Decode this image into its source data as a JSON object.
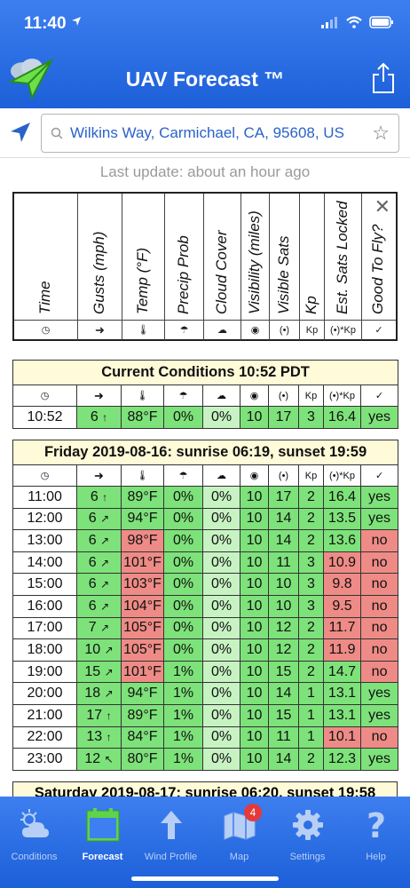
{
  "status": {
    "time": "11:40"
  },
  "header": {
    "title": "UAV Forecast ™"
  },
  "search": {
    "text": "Wilkins Way, Carmichael, CA, 95608, US"
  },
  "last_update": "Last update: about an hour ago",
  "legend": {
    "columns": [
      "Time",
      "Gusts (mph)",
      "Temp (°F)",
      "Precip Prob",
      "Cloud Cover",
      "Visibility (miles)",
      "Visible Sats",
      "Kp",
      "Est. Sats Locked",
      "Good To Fly?"
    ],
    "icons": [
      "clock-icon",
      "arrow-icon",
      "thermometer-icon",
      "rain-cloud-icon",
      "cloud-icon",
      "eye-icon",
      "satellite-icon",
      "kp-text",
      "sats-kp-text",
      "check-circle-icon"
    ],
    "kp_label": "Kp",
    "sats_kp_label": "(•)*Kp"
  },
  "current": {
    "title": "Current Conditions 10:52 PDT",
    "row": {
      "time": "10:52",
      "gust": "6",
      "arrow": "↑",
      "temp": "88°F",
      "precip": "0%",
      "cloud": "0%",
      "vis": "10",
      "sats": "17",
      "kp": "3",
      "locked": "16.4",
      "fly": "yes"
    }
  },
  "friday": {
    "title": "Friday 2019-08-16: sunrise 06:19, sunset 19:59",
    "rows": [
      {
        "time": "11:00",
        "gust": "6",
        "arrow": "↑",
        "temp": "89°F",
        "temp_c": "g",
        "precip": "0%",
        "cloud": "0%",
        "vis": "10",
        "sats": "17",
        "kp": "2",
        "locked": "16.4",
        "locked_c": "g",
        "fly": "yes",
        "fly_c": "g"
      },
      {
        "time": "12:00",
        "gust": "6",
        "arrow": "↗",
        "temp": "94°F",
        "temp_c": "g",
        "precip": "0%",
        "cloud": "0%",
        "vis": "10",
        "sats": "14",
        "kp": "2",
        "locked": "13.5",
        "locked_c": "g",
        "fly": "yes",
        "fly_c": "g"
      },
      {
        "time": "13:00",
        "gust": "6",
        "arrow": "↗",
        "temp": "98°F",
        "temp_c": "r",
        "precip": "0%",
        "cloud": "0%",
        "vis": "10",
        "sats": "14",
        "kp": "2",
        "locked": "13.6",
        "locked_c": "g",
        "fly": "no",
        "fly_c": "r"
      },
      {
        "time": "14:00",
        "gust": "6",
        "arrow": "↗",
        "temp": "101°F",
        "temp_c": "r",
        "precip": "0%",
        "cloud": "0%",
        "vis": "10",
        "sats": "11",
        "kp": "3",
        "locked": "10.9",
        "locked_c": "r",
        "fly": "no",
        "fly_c": "r"
      },
      {
        "time": "15:00",
        "gust": "6",
        "arrow": "↗",
        "temp": "103°F",
        "temp_c": "r",
        "precip": "0%",
        "cloud": "0%",
        "vis": "10",
        "sats": "10",
        "kp": "3",
        "locked": "9.8",
        "locked_c": "r",
        "fly": "no",
        "fly_c": "r"
      },
      {
        "time": "16:00",
        "gust": "6",
        "arrow": "↗",
        "temp": "104°F",
        "temp_c": "r",
        "precip": "0%",
        "cloud": "0%",
        "vis": "10",
        "sats": "10",
        "kp": "3",
        "locked": "9.5",
        "locked_c": "r",
        "fly": "no",
        "fly_c": "r"
      },
      {
        "time": "17:00",
        "gust": "7",
        "arrow": "↗",
        "temp": "105°F",
        "temp_c": "r",
        "precip": "0%",
        "cloud": "0%",
        "vis": "10",
        "sats": "12",
        "kp": "2",
        "locked": "11.7",
        "locked_c": "r",
        "fly": "no",
        "fly_c": "r"
      },
      {
        "time": "18:00",
        "gust": "10",
        "arrow": "↗",
        "temp": "105°F",
        "temp_c": "r",
        "precip": "0%",
        "cloud": "0%",
        "vis": "10",
        "sats": "12",
        "kp": "2",
        "locked": "11.9",
        "locked_c": "r",
        "fly": "no",
        "fly_c": "r"
      },
      {
        "time": "19:00",
        "gust": "15",
        "arrow": "↗",
        "temp": "101°F",
        "temp_c": "r",
        "precip": "1%",
        "cloud": "0%",
        "vis": "10",
        "sats": "15",
        "kp": "2",
        "locked": "14.7",
        "locked_c": "g",
        "fly": "no",
        "fly_c": "r"
      },
      {
        "time": "20:00",
        "gust": "18",
        "arrow": "↗",
        "temp": "94°F",
        "temp_c": "g",
        "precip": "1%",
        "cloud": "0%",
        "vis": "10",
        "sats": "14",
        "kp": "1",
        "locked": "13.1",
        "locked_c": "g",
        "fly": "yes",
        "fly_c": "g"
      },
      {
        "time": "21:00",
        "gust": "17",
        "arrow": "↑",
        "temp": "89°F",
        "temp_c": "g",
        "precip": "1%",
        "cloud": "0%",
        "vis": "10",
        "sats": "15",
        "kp": "1",
        "locked": "13.1",
        "locked_c": "g",
        "fly": "yes",
        "fly_c": "g"
      },
      {
        "time": "22:00",
        "gust": "13",
        "arrow": "↑",
        "temp": "84°F",
        "temp_c": "g",
        "precip": "1%",
        "cloud": "0%",
        "vis": "10",
        "sats": "11",
        "kp": "1",
        "locked": "10.1",
        "locked_c": "r",
        "fly": "no",
        "fly_c": "r"
      },
      {
        "time": "23:00",
        "gust": "12",
        "arrow": "↖",
        "temp": "80°F",
        "temp_c": "g",
        "precip": "1%",
        "cloud": "0%",
        "vis": "10",
        "sats": "14",
        "kp": "2",
        "locked": "12.3",
        "locked_c": "g",
        "fly": "yes",
        "fly_c": "g"
      }
    ]
  },
  "saturday": {
    "title": "Saturday 2019-08-17: sunrise 06:20, sunset 19:58"
  },
  "tabs": [
    {
      "label": "Conditions",
      "icon": "cloud-sun-icon"
    },
    {
      "label": "Forecast",
      "icon": "calendar-icon"
    },
    {
      "label": "Wind Profile",
      "icon": "up-arrow-icon"
    },
    {
      "label": "Map",
      "icon": "map-icon",
      "badge": "4"
    },
    {
      "label": "Settings",
      "icon": "gear-icon"
    },
    {
      "label": "Help",
      "icon": "question-icon"
    }
  ],
  "colors": {
    "header": "#2d6fe4",
    "good": "#7de27a",
    "light_good": "#c7f3c3",
    "bad": "#ee8b86",
    "title_bg": "#fffbd8"
  }
}
